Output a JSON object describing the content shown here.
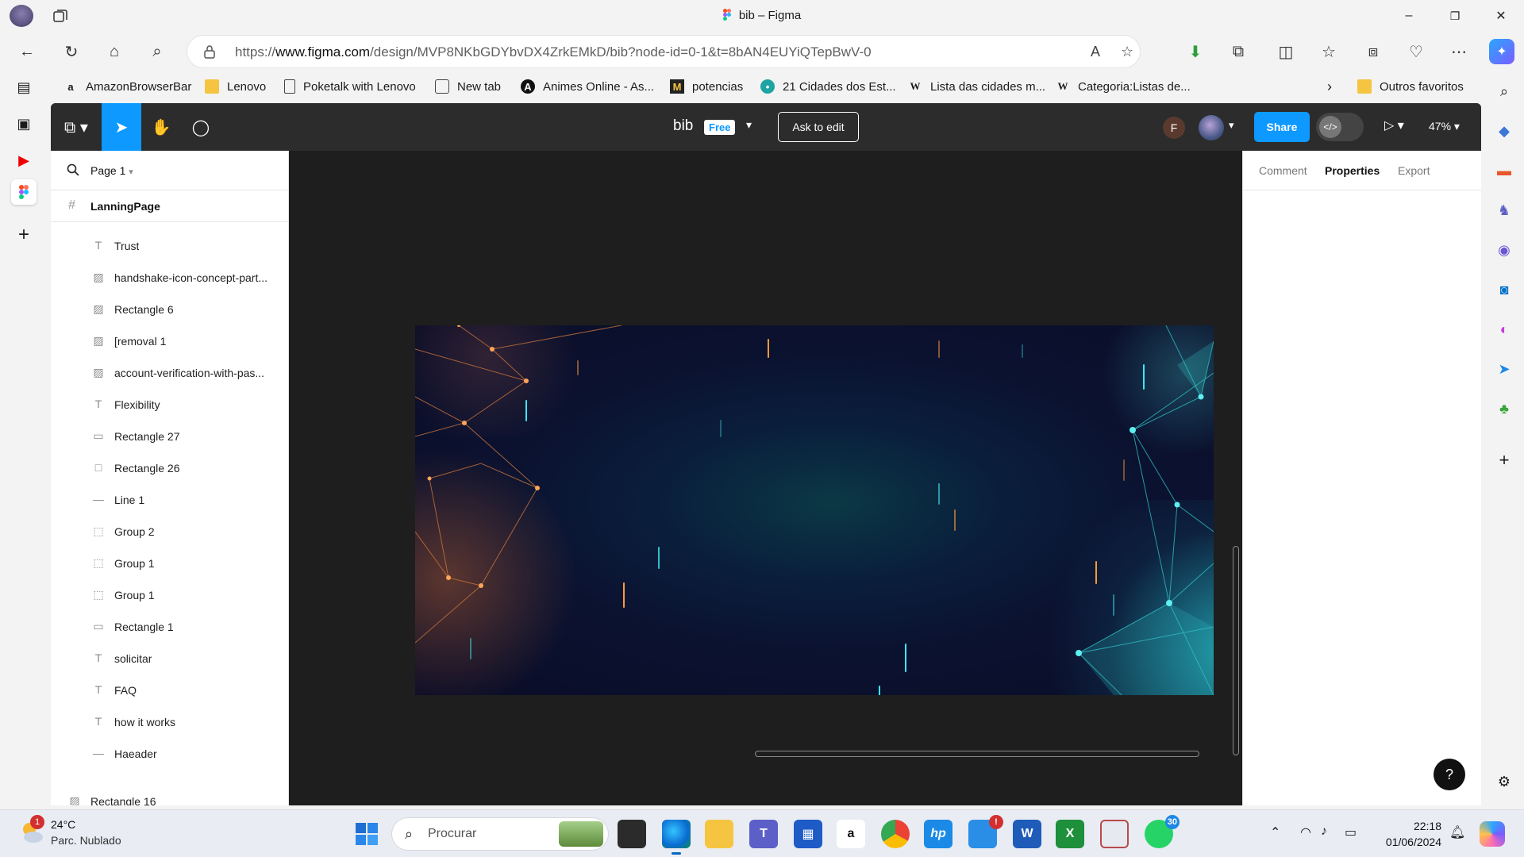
{
  "window": {
    "title": "bib – Figma",
    "minimize": "–",
    "restore": "❐",
    "close": "✕"
  },
  "browser": {
    "url_prefix": "https://",
    "url_host": "www.figma.com",
    "url_path": "/design/MVP8NKbGDYbvDX4ZrkEMkD/bib?node-id=0-1&t=8bAN4EUYiQTepBwV-0"
  },
  "favorites": [
    {
      "label": "AmazonBrowserBar",
      "icon": "amazon-icon"
    },
    {
      "label": "Lenovo",
      "icon": "folder-icon"
    },
    {
      "label": "Poketalk with Lenovo",
      "icon": "page-icon"
    },
    {
      "label": "New tab",
      "icon": "newtab-icon"
    },
    {
      "label": "Animes Online - As...",
      "icon": "anime-icon"
    },
    {
      "label": "potencias",
      "icon": "m-icon"
    },
    {
      "label": "21 Cidades dos Est...",
      "icon": "cities-icon"
    },
    {
      "label": "Lista das cidades m...",
      "icon": "wikipedia-icon"
    },
    {
      "label": "Categoria:Listas de...",
      "icon": "wikipedia-icon"
    }
  ],
  "favorites_other": "Outros favoritos",
  "figma": {
    "file_name": "bib",
    "plan_badge": "Free",
    "ask_to_edit": "Ask to edit",
    "avatar_initial": "F",
    "share": "Share",
    "zoom": "47%",
    "page": "Page 1",
    "frame": "LanningPage",
    "layers": [
      {
        "name": "Trust",
        "type": "text"
      },
      {
        "name": "handshake-icon-concept-part...",
        "type": "image"
      },
      {
        "name": "Rectangle 6",
        "type": "image"
      },
      {
        "name": "[removal 1",
        "type": "image"
      },
      {
        "name": "account-verification-with-pas...",
        "type": "image"
      },
      {
        "name": "Flexibility",
        "type": "text"
      },
      {
        "name": "Rectangle 27",
        "type": "rect-thin"
      },
      {
        "name": "Rectangle 26",
        "type": "rect"
      },
      {
        "name": "Line 1",
        "type": "line"
      },
      {
        "name": "Group 2",
        "type": "group"
      },
      {
        "name": "Group 1",
        "type": "group"
      },
      {
        "name": "Group 1",
        "type": "group"
      },
      {
        "name": "Rectangle 1",
        "type": "rect-thin"
      },
      {
        "name": "solicitar",
        "type": "text"
      },
      {
        "name": "FAQ",
        "type": "text"
      },
      {
        "name": "how it works",
        "type": "text"
      },
      {
        "name": "Haeader",
        "type": "line"
      }
    ],
    "top_layer": {
      "name": "Rectangle 16",
      "type": "image"
    },
    "tabs": {
      "comment": "Comment",
      "properties": "Properties",
      "export": "Export"
    },
    "help": "?"
  },
  "taskbar": {
    "weather_badge": "1",
    "temperature": "24°C",
    "weather": "Parc. Nublado",
    "search_placeholder": "Procurar",
    "apps": [
      {
        "name": "task-view",
        "label": ""
      },
      {
        "name": "edge",
        "label": ""
      },
      {
        "name": "file-explorer",
        "label": ""
      },
      {
        "name": "teams",
        "label": ""
      },
      {
        "name": "microsoft-store",
        "label": ""
      },
      {
        "name": "amazon",
        "label": "a"
      },
      {
        "name": "chrome",
        "label": ""
      },
      {
        "name": "myhp",
        "label": "hp"
      },
      {
        "name": "figma-pwa",
        "label": "",
        "badge": "!"
      },
      {
        "name": "word",
        "label": "W"
      },
      {
        "name": "photos",
        "label": ""
      },
      {
        "name": "whatsapp",
        "label": "",
        "badge": "30"
      }
    ],
    "time": "22:18",
    "date": "01/06/2024"
  }
}
